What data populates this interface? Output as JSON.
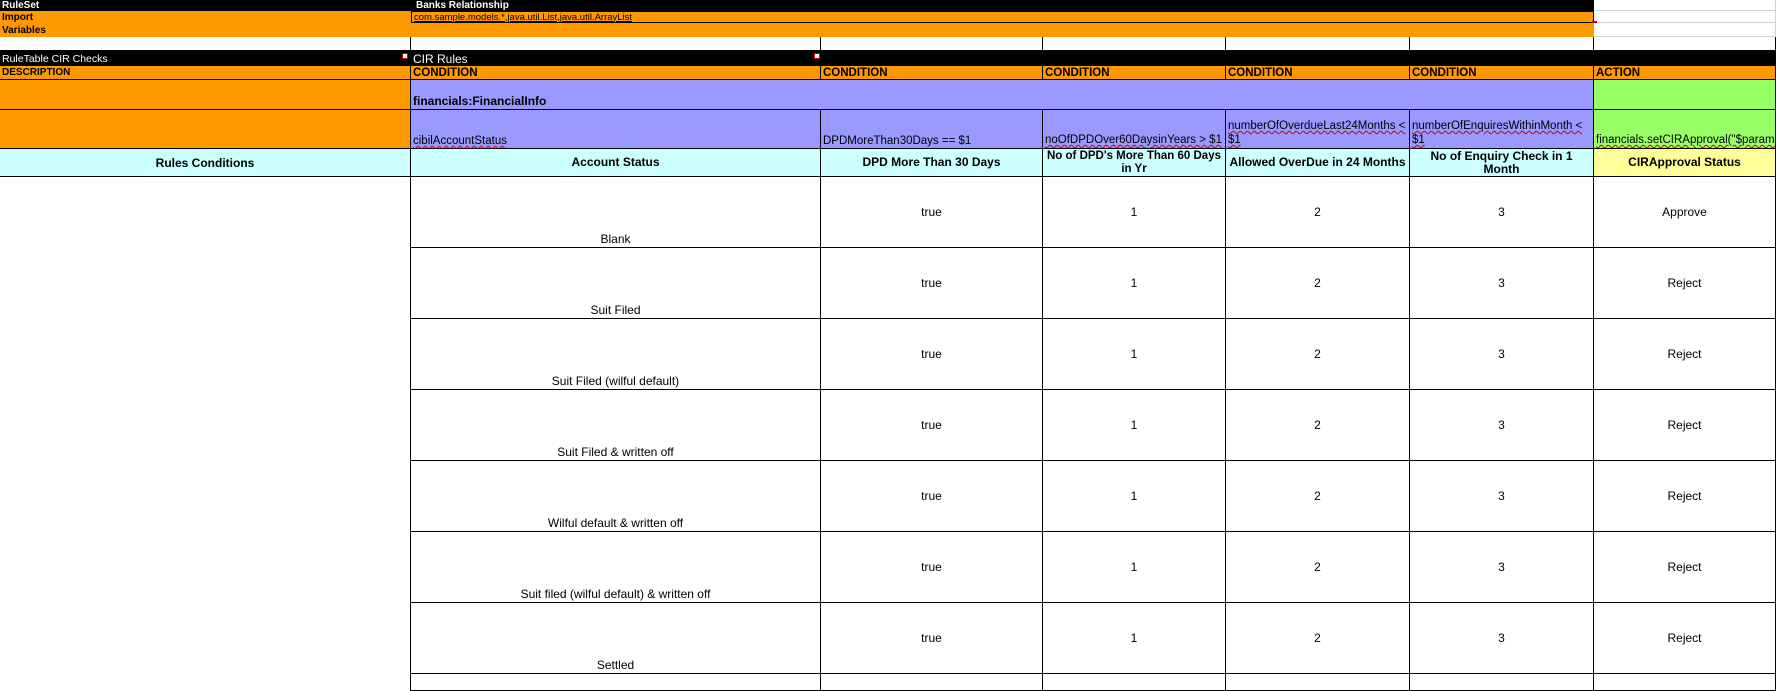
{
  "meta": {
    "ruleset_label": "RuleSet",
    "ruleset_value": "Banks Relationship",
    "import_label": "Import",
    "import_value": "com.sample.models.*,java.util.List,java.util.ArrayList",
    "variables_label": "Variables"
  },
  "ruletable": {
    "name": "RuleTable CIR  Checks",
    "title": "CIR Rules",
    "description_label": "DESCRIPTION",
    "object_binding": "financials:FinancialInfo"
  },
  "colors": {
    "header_black": "#000000",
    "orange": "#ff9900",
    "purple": "#9999ff",
    "green": "#99ff66",
    "cyan": "#ccffff",
    "yellow": "#ffff99",
    "grid": "#000000"
  },
  "columns": [
    {
      "type": "CONDITION",
      "expression": "cibilAccountStatus",
      "label": "Account Status"
    },
    {
      "type": "CONDITION",
      "expression": "DPDMoreThan30Days == $1",
      "label": "DPD More Than 30 Days"
    },
    {
      "type": "CONDITION",
      "expression": "noOfDPDOver60DaysinYears > $1",
      "label": "No of DPD's More Than 60 Days in Yr"
    },
    {
      "type": "CONDITION",
      "expression": "numberOfOverdueLast24Months < $1",
      "label": "Allowed OverDue in 24 Months"
    },
    {
      "type": "CONDITION",
      "expression": "numberOfEnquiresWithinMonth < $1",
      "label": "No of Enquiry Check  in 1 Month"
    },
    {
      "type": "ACTION",
      "expression": "financials.setCIRApproval(\"$param\");",
      "label": "CIRApproval Status"
    }
  ],
  "rules_conditions_label": "Rules Conditions",
  "rows": [
    {
      "account_status": "Blank",
      "dpd30": "true",
      "dpd60": "1",
      "overdue24": "2",
      "enquiry": "3",
      "approval": "Approve"
    },
    {
      "account_status": "Suit Filed",
      "dpd30": "true",
      "dpd60": "1",
      "overdue24": "2",
      "enquiry": "3",
      "approval": "Reject"
    },
    {
      "account_status": "Suit Filed (wilful default)",
      "dpd30": "true",
      "dpd60": "1",
      "overdue24": "2",
      "enquiry": "3",
      "approval": "Reject"
    },
    {
      "account_status": "Suit Filed & written off",
      "dpd30": "true",
      "dpd60": "1",
      "overdue24": "2",
      "enquiry": "3",
      "approval": "Reject"
    },
    {
      "account_status": "Wilful default & written off",
      "dpd30": "true",
      "dpd60": "1",
      "overdue24": "2",
      "enquiry": "3",
      "approval": "Reject"
    },
    {
      "account_status": "Suit filed (wilful default) & written off",
      "dpd30": "true",
      "dpd60": "1",
      "overdue24": "2",
      "enquiry": "3",
      "approval": "Reject"
    },
    {
      "account_status": "Settled",
      "dpd30": "true",
      "dpd60": "1",
      "overdue24": "2",
      "enquiry": "3",
      "approval": "Reject"
    }
  ]
}
